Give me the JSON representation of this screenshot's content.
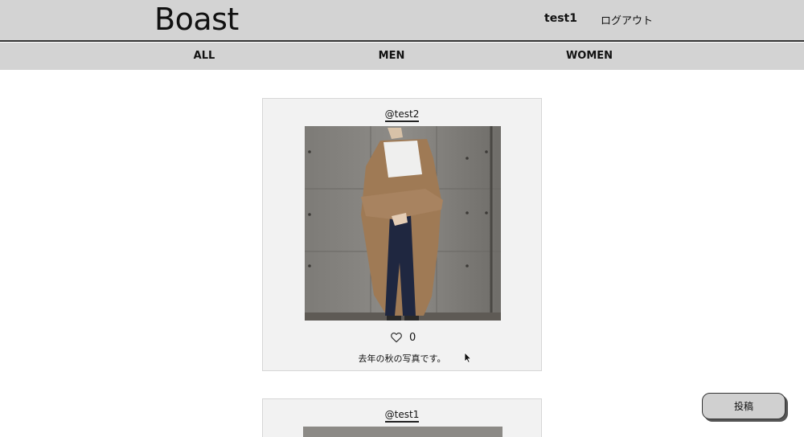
{
  "header": {
    "logo": "Boast",
    "user_name": "test1",
    "logout_label": "ログアウト"
  },
  "categories": [
    {
      "label": "ALL"
    },
    {
      "label": "MEN"
    },
    {
      "label": "WOMEN"
    }
  ],
  "posts": [
    {
      "user": "@test2",
      "likes": "0",
      "caption": "去年の秋の写真です。",
      "image": "photo of person in beige cardigan in front of concrete wall"
    },
    {
      "user": "@test1",
      "likes": "",
      "caption": "",
      "image": "photo (partially visible)"
    }
  ],
  "actions": {
    "post_button_label": "投稿"
  },
  "icons": {
    "like": "heart-outline-icon",
    "cursor": "mouse-cursor-icon"
  },
  "colors": {
    "header_bg": "#d3d3d3",
    "card_bg": "#f2f2f2",
    "page_bg": "#ffffff"
  }
}
